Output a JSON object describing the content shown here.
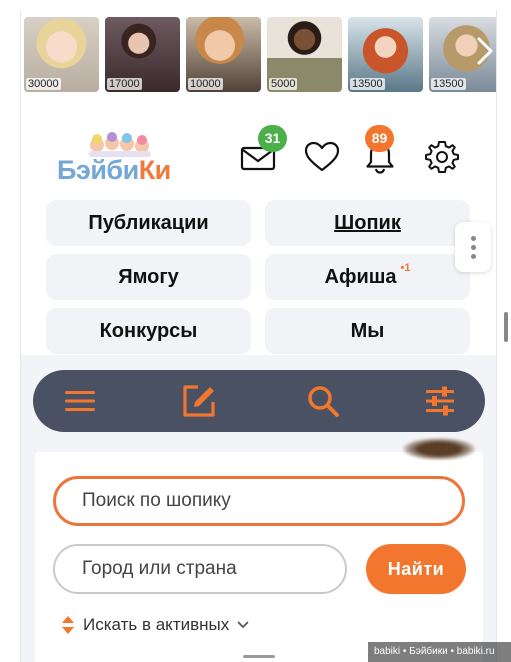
{
  "carousel": {
    "items": [
      {
        "price": "30000"
      },
      {
        "price": "17000"
      },
      {
        "price": "10000"
      },
      {
        "price": "5000"
      },
      {
        "price": "13500"
      },
      {
        "price": "13500"
      }
    ],
    "next_icon": "chevron-right-icon"
  },
  "header": {
    "logo": {
      "part1": "Бэйби",
      "part2": "Ки"
    },
    "mail_count": "31",
    "notification_count": "89",
    "icons": [
      "mail-icon",
      "heart-icon",
      "bell-icon",
      "gear-icon"
    ]
  },
  "nav": {
    "publications": "Публикации",
    "shop": "Шопик",
    "yamogu": "Ямогу",
    "afisha": "Афиша",
    "afisha_count": "•1",
    "contests": "Конкурсы",
    "we": "Мы"
  },
  "toolbar": {
    "icons": [
      "menu-icon",
      "edit-icon",
      "search-icon",
      "filter-icon"
    ]
  },
  "search": {
    "placeholder": "Поиск по шопику",
    "city_placeholder": "Город или страна",
    "find_label": "Найти",
    "sort_label": "Искать в активных"
  },
  "watermark": "babiki • Бэйбики • babiki.ru",
  "colors": {
    "accent": "#f3762f",
    "toolbar": "#4a5162",
    "badge_green": "#4cb04a",
    "logo_blue": "#74a6d6"
  }
}
